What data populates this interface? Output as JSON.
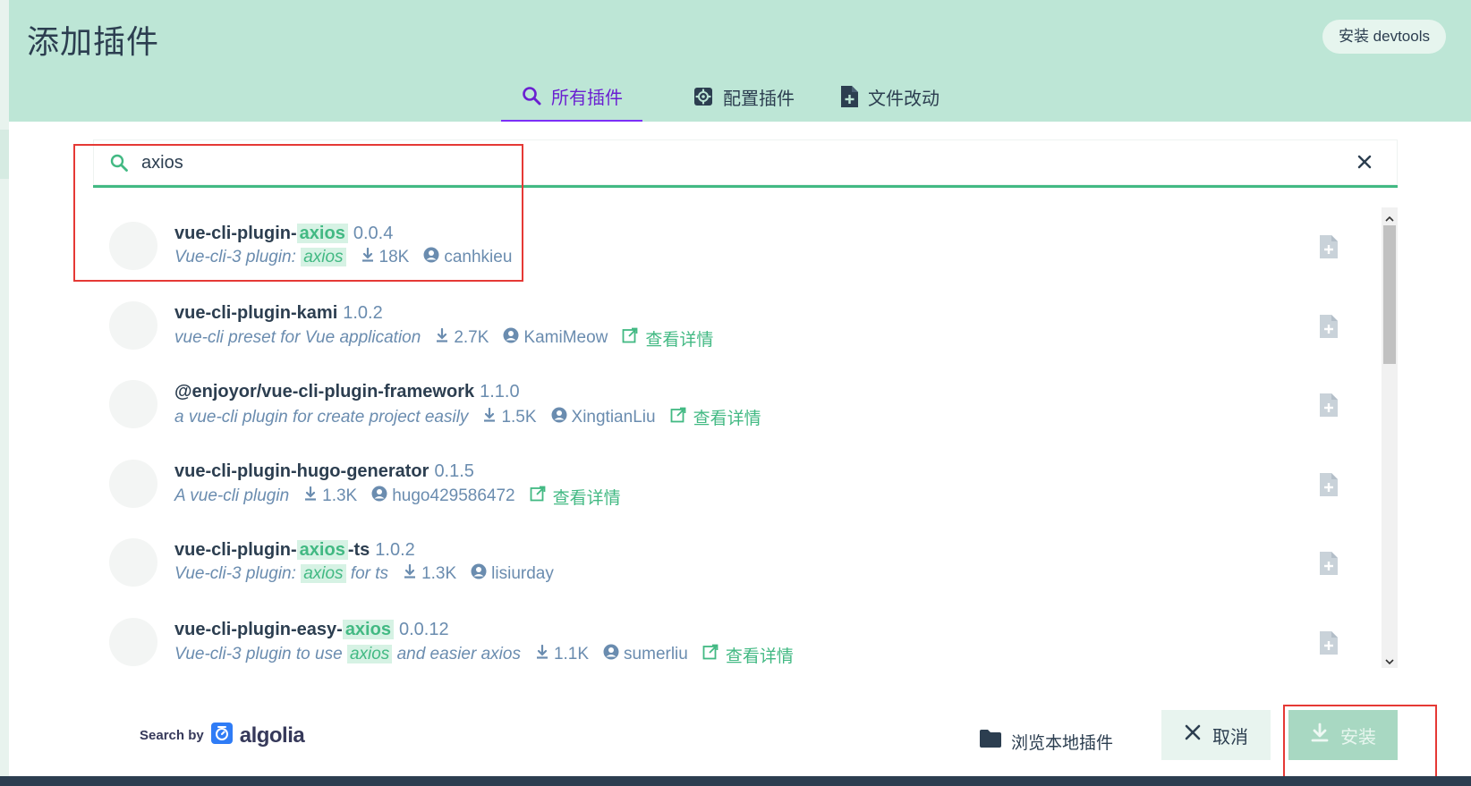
{
  "header": {
    "title": "添加插件",
    "devtools_label": "安装 devtools"
  },
  "tabs": [
    {
      "label": "所有插件",
      "icon": "search-icon",
      "active": true
    },
    {
      "label": "配置插件",
      "icon": "gear-icon",
      "active": false
    },
    {
      "label": "文件改动",
      "icon": "file-add-icon",
      "active": false
    }
  ],
  "search": {
    "value": "axios",
    "placeholder": ""
  },
  "plugins": [
    {
      "name_pre": "vue-cli-plugin-",
      "name_hl": "axios",
      "name_post": "",
      "version": "0.0.4",
      "desc_pre": "Vue-cli-3 plugin: ",
      "desc_hl": "axios",
      "desc_post": "",
      "downloads": "18K",
      "author": "canhkieu",
      "details": ""
    },
    {
      "name_pre": "vue-cli-plugin-kami",
      "name_hl": "",
      "name_post": "",
      "version": "1.0.2",
      "desc_pre": "vue-cli preset for Vue application",
      "desc_hl": "",
      "desc_post": "",
      "downloads": "2.7K",
      "author": "KamiMeow",
      "details": "查看详情"
    },
    {
      "name_pre": "@enjoyor/vue-cli-plugin-framework",
      "name_hl": "",
      "name_post": "",
      "version": "1.1.0",
      "desc_pre": "a vue-cli plugin for create project easily",
      "desc_hl": "",
      "desc_post": "",
      "downloads": "1.5K",
      "author": "XingtianLiu",
      "details": "查看详情"
    },
    {
      "name_pre": "vue-cli-plugin-hugo-generator",
      "name_hl": "",
      "name_post": "",
      "version": "0.1.5",
      "desc_pre": "A vue-cli plugin",
      "desc_hl": "",
      "desc_post": "",
      "downloads": "1.3K",
      "author": "hugo429586472",
      "details": "查看详情"
    },
    {
      "name_pre": "vue-cli-plugin-",
      "name_hl": "axios",
      "name_post": "-ts",
      "version": "1.0.2",
      "desc_pre": "Vue-cli-3 plugin: ",
      "desc_hl": "axios",
      "desc_post": " for ts",
      "downloads": "1.3K",
      "author": "lisiurday",
      "details": ""
    },
    {
      "name_pre": "vue-cli-plugin-easy-",
      "name_hl": "axios",
      "name_post": "",
      "version": "0.0.12",
      "desc_pre": "Vue-cli-3 plugin to use ",
      "desc_hl": "axios",
      "desc_post": " and easier axios",
      "downloads": "1.1K",
      "author": "sumerliu",
      "details": "查看详情"
    }
  ],
  "footer": {
    "search_by": "Search by",
    "algolia": "algolia",
    "browse_label": "浏览本地插件",
    "cancel_label": "取消",
    "install_label": "安装"
  },
  "colors": {
    "accent": "#42b983",
    "header_bg": "#bde6d6",
    "tab_active": "#7b2ff7",
    "annotation": "#e53935"
  }
}
